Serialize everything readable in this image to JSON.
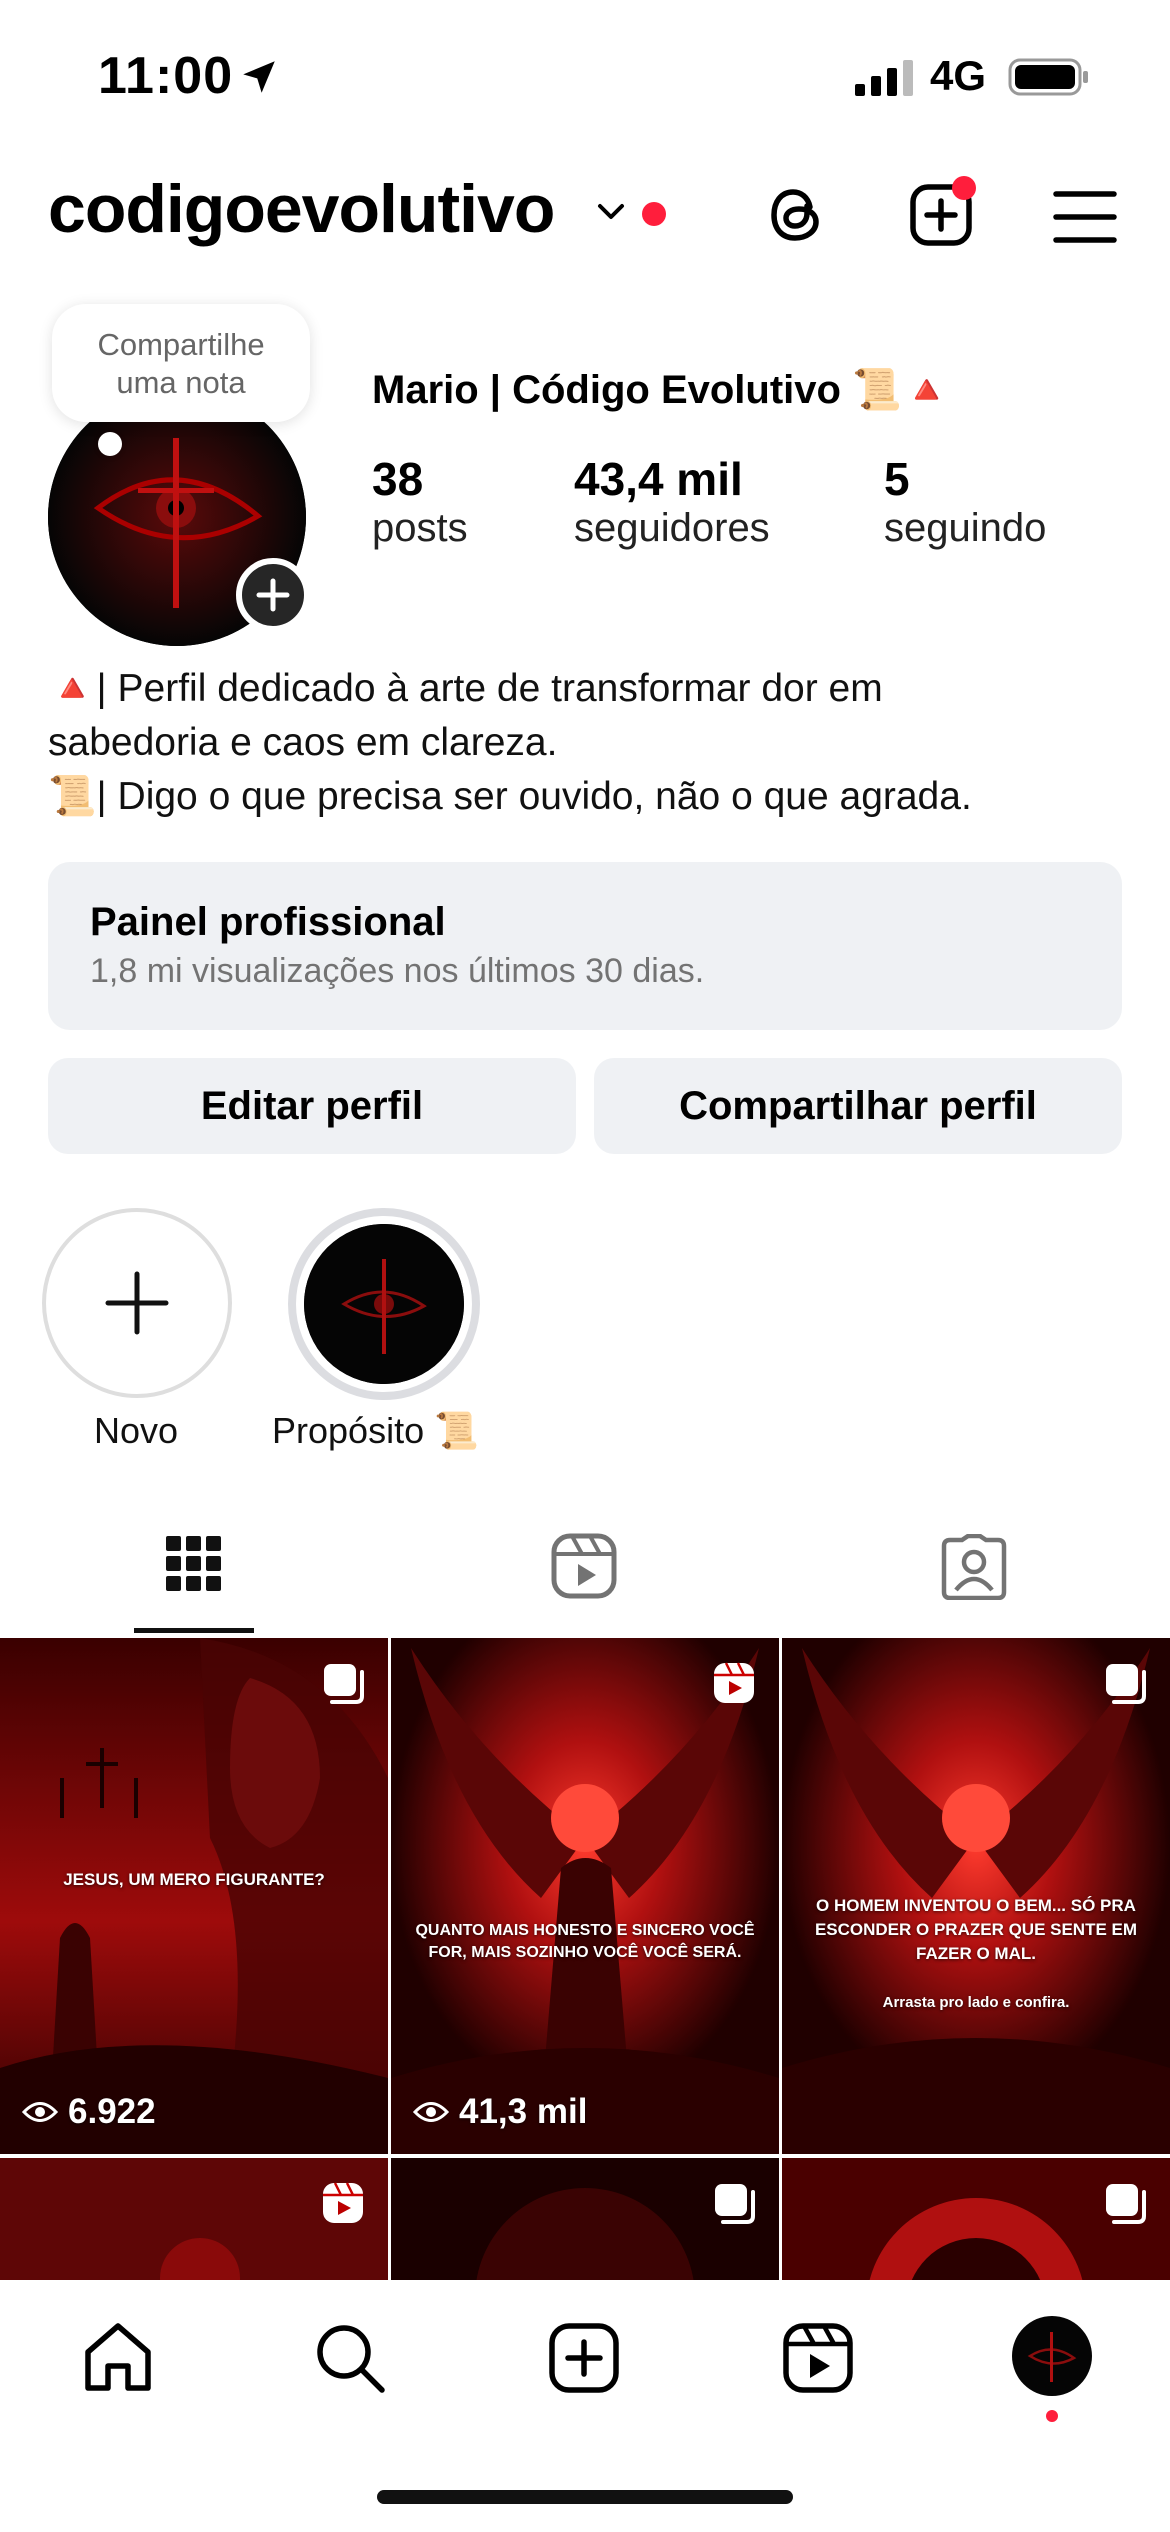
{
  "status_bar": {
    "time": "11:00",
    "network": "4G"
  },
  "header": {
    "username": "codigoevolutivo"
  },
  "note": {
    "text_line1": "Compartilhe",
    "text_line2": "uma nota"
  },
  "profile": {
    "display_name": "Mario | Código Evolutivo 📜🔺",
    "stats": [
      {
        "value": "38",
        "label": "posts"
      },
      {
        "value": "43,4 mil",
        "label": "seguidores"
      },
      {
        "value": "5",
        "label": "seguindo"
      }
    ],
    "bio_line1": "🔺| Perfil dedicado à arte de transformar dor em",
    "bio_line2": "sabedoria e caos em clareza.",
    "bio_line3": "📜| Digo o que precisa ser ouvido, não o que agrada."
  },
  "dashboard": {
    "title": "Painel profissional",
    "subtitle": "1,8 mi visualizações nos últimos 30 dias."
  },
  "buttons": {
    "edit": "Editar perfil",
    "share": "Compartilhar perfil"
  },
  "highlights": [
    {
      "label": "Novo"
    },
    {
      "label": "Propósito 📜"
    }
  ],
  "posts": [
    {
      "text": "JESUS, UM MERO FIGURANTE?",
      "views": "6.922",
      "badge": "carousel"
    },
    {
      "text": "QUANTO MAIS HONESTO E SINCERO VOCÊ FOR, MAIS SOZINHO VOCÊ VOCÊ SERÁ.",
      "views": "41,3 mil",
      "badge": "reel"
    },
    {
      "text": "O HOMEM INVENTOU O BEM... SÓ PRA ESCONDER O PRAZER QUE SENTE EM FAZER O MAL.",
      "subtext": "Arrasta pro lado e confira.",
      "badge": "carousel"
    }
  ],
  "colors": {
    "accent_red": "#ff1e3c",
    "panel_bg": "#eff1f4"
  }
}
